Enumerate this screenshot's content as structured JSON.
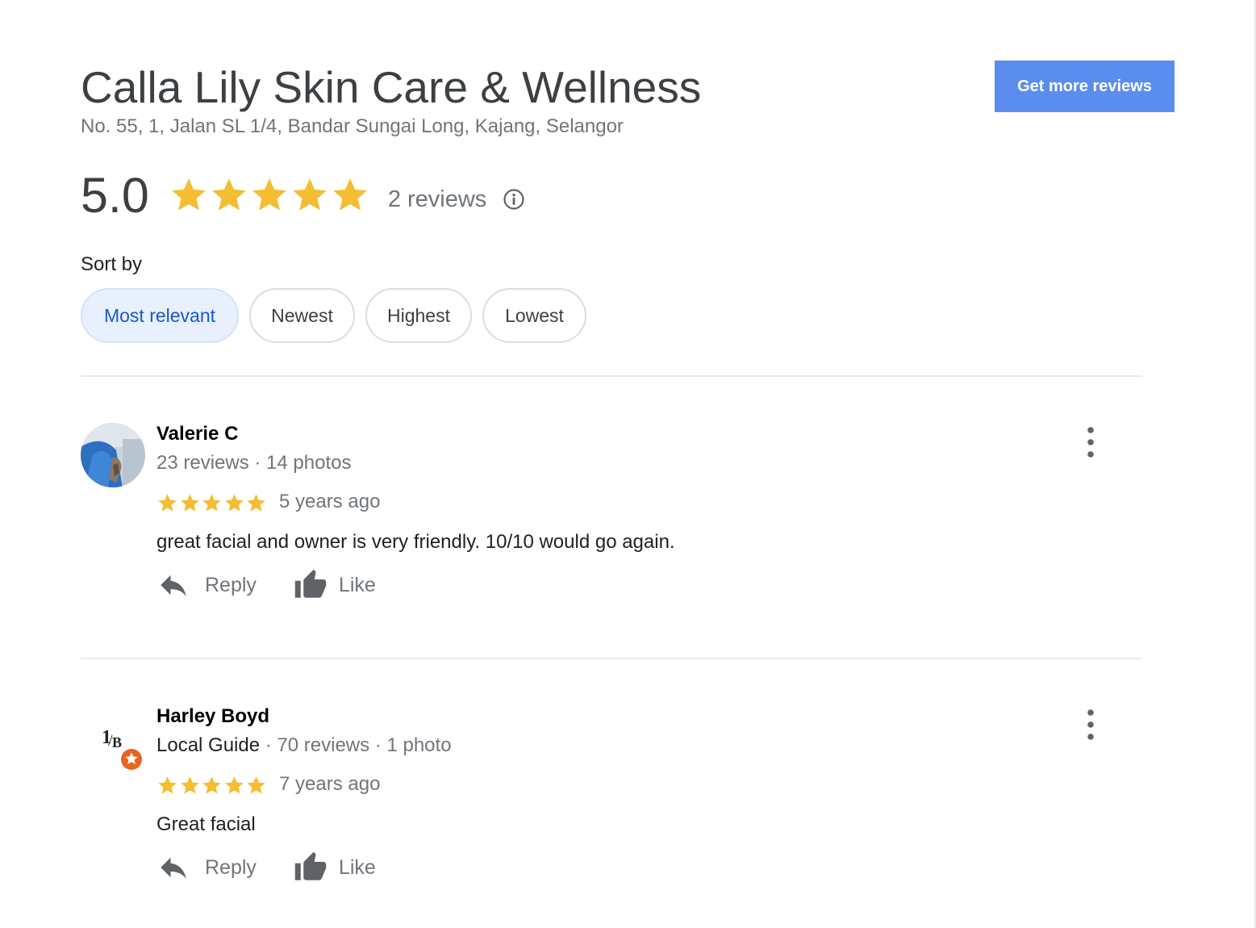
{
  "business": {
    "name": "Calla Lily Skin Care & Wellness",
    "address": "No. 55, 1, Jalan SL 1/4, Bandar Sungai Long, Kajang, Selangor"
  },
  "header": {
    "get_more_reviews_label": "Get more reviews"
  },
  "rating": {
    "value": "5.0",
    "stars": 5,
    "review_count": "2 reviews"
  },
  "sort": {
    "label": "Sort by",
    "options": [
      "Most relevant",
      "Newest",
      "Highest",
      "Lowest"
    ],
    "selected": "Most relevant"
  },
  "reviews": [
    {
      "name": "Valerie C",
      "meta": "23 reviews · 14 photos",
      "stars": 5,
      "age": "5 years ago",
      "text": "great facial and owner is very friendly. 10/10 would go again.",
      "reply_label": "Reply",
      "like_label": "Like"
    },
    {
      "name": "Harley Boyd",
      "badge": "Local Guide",
      "meta": " · 70 reviews · 1 photo",
      "stars": 5,
      "age": "7 years ago",
      "text": "Great facial",
      "reply_label": "Reply",
      "like_label": "Like"
    }
  ],
  "colors": {
    "accent_button": "#5b8def",
    "star": "#f4bd32",
    "chip_active_bg": "#e8f0fe",
    "chip_active_text": "#1a57c9",
    "local_guide_badge": "#e8651e"
  }
}
